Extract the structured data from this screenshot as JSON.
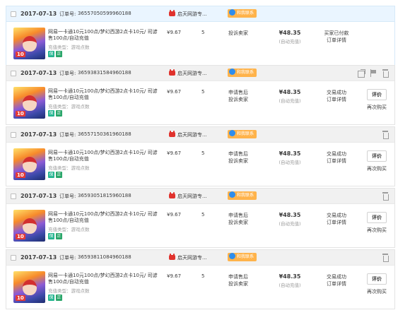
{
  "orders": [
    {
      "date": "2017-07-13",
      "order_number_label": "订单号:",
      "order_number": "36557050599960188",
      "shop": "启天网游专...",
      "contact": "和我联系",
      "item_name": "网易一卡通10元100点/梦幻西游2点卡10元/ 司谚售100点/自动充值",
      "item_type": "充值类型：游戏点数",
      "badges": [
        "保",
        "正"
      ],
      "price": "¥9.67",
      "qty": "5",
      "after_sale": "投诉卖家",
      "total": "¥48.35",
      "delivery": "(自动充值)",
      "status": "买家已付款",
      "status2": "订单详情",
      "icons": [],
      "action": "",
      "rebuy": ""
    },
    {
      "date": "2017-07-13",
      "order_number_label": "订单号:",
      "order_number": "36593831584960188",
      "shop": "启天网游专...",
      "contact": "和我联系",
      "item_name": "网易一卡通10元100点/梦幻西游2点卡10元/ 司谚售100点/自动充值",
      "item_type": "充值类型：游戏点数",
      "badges": [
        "保",
        "正"
      ],
      "price": "¥9.67",
      "qty": "5",
      "after_sale": "申请售后\n投诉卖家",
      "total": "¥48.35",
      "delivery": "(自动充值)",
      "status": "交易成功",
      "status2": "订单详情",
      "icons": [
        "share-icon",
        "flag-icon",
        "trash-icon"
      ],
      "action": "评价",
      "rebuy": "再次购买"
    },
    {
      "date": "2017-07-13",
      "order_number_label": "订单号:",
      "order_number": "36557150361960188",
      "shop": "启天网游专...",
      "contact": "和我联系",
      "item_name": "网易一卡通10元100点/梦幻西游2点卡10元/ 司谚售100点/自动充值",
      "item_type": "充值类型：游戏点数",
      "badges": [
        "保",
        "正"
      ],
      "price": "¥9.67",
      "qty": "5",
      "after_sale": "申请售后\n投诉卖家",
      "total": "¥48.35",
      "delivery": "(自动充值)",
      "status": "交易成功",
      "status2": "订单详情",
      "icons": [
        "trash-icon"
      ],
      "action": "评价",
      "rebuy": "再次购买"
    },
    {
      "date": "2017-07-13",
      "order_number_label": "订单号:",
      "order_number": "36593051815960188",
      "shop": "启天网游专...",
      "contact": "和我联系",
      "item_name": "网易一卡通10元100点/梦幻西游2点卡10元/ 司谚售100点/自动充值",
      "item_type": "充值类型：游戏点数",
      "badges": [
        "保",
        "正"
      ],
      "price": "¥9.67",
      "qty": "5",
      "after_sale": "申请售后\n投诉卖家",
      "total": "¥48.35",
      "delivery": "(自动充值)",
      "status": "交易成功",
      "status2": "订单详情",
      "icons": [
        "trash-icon"
      ],
      "action": "评价",
      "rebuy": "再次购买"
    },
    {
      "date": "2017-07-13",
      "order_number_label": "订单号:",
      "order_number": "36593811084960188",
      "shop": "启天网游专...",
      "contact": "和我联系",
      "item_name": "网易一卡通10元100点/梦幻西游2点卡10元/ 司谚售100点/自动充值",
      "item_type": "充值类型：游戏点数",
      "badges": [
        "保",
        "正"
      ],
      "price": "¥9.67",
      "qty": "5",
      "after_sale": "申请售后\n投诉卖家",
      "total": "¥48.35",
      "delivery": "(自动充值)",
      "status": "交易成功",
      "status2": "订单详情",
      "icons": [
        "trash-icon"
      ],
      "action": "评价",
      "rebuy": "再次购买"
    }
  ],
  "thumb_tag": "10",
  "colors": {
    "shop_icon": "#e0322d",
    "contact_badge": "#ffb34b",
    "contact_icon": "#2e8ded",
    "badge_guarantee": "#23b58f",
    "badge_genuine": "#2aa66a"
  }
}
